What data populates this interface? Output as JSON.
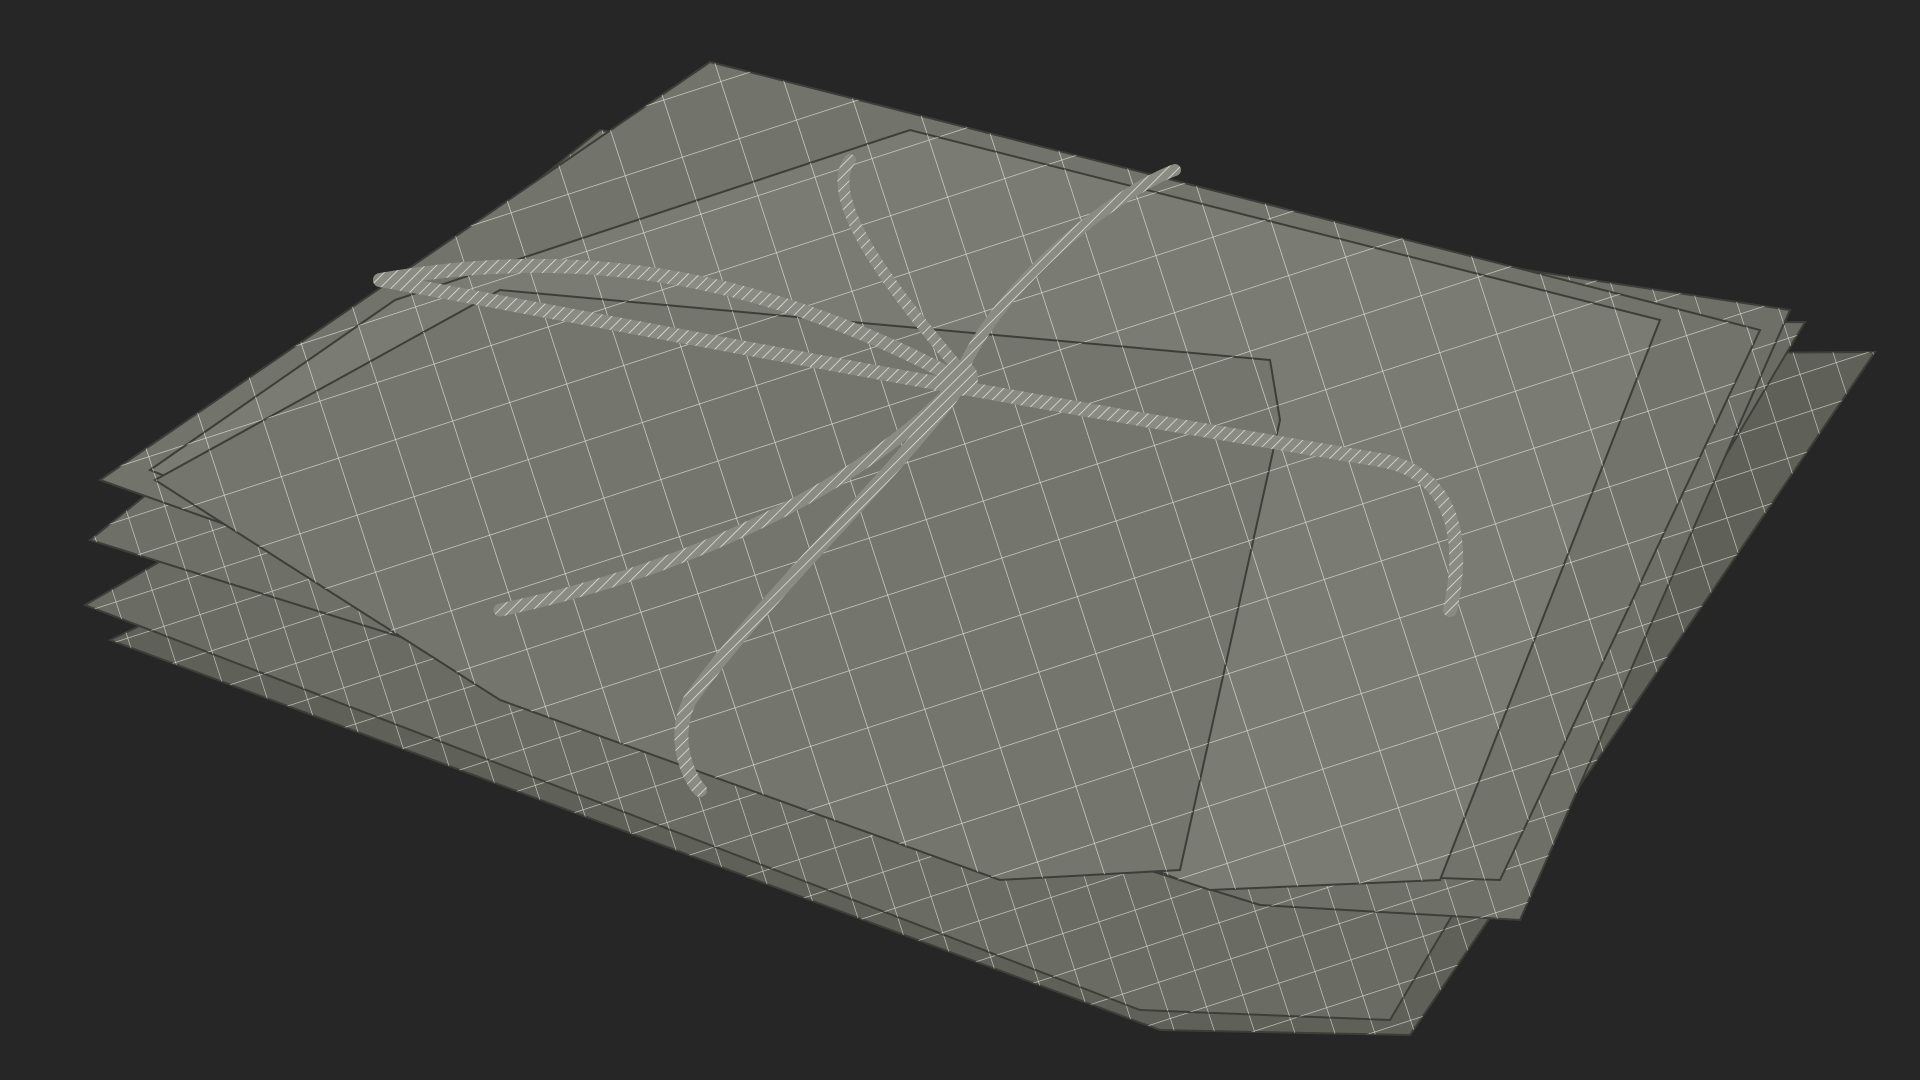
{
  "scene": {
    "subject": "wireframe-render",
    "colors": {
      "background": "#262626",
      "surface_light": "#7d7e75",
      "surface": "#72746b",
      "surface_dark": "#5f6159",
      "edge_shadow": "#3d3e39",
      "wire": "#e6e6dc",
      "twine": "#8a8b82"
    }
  }
}
